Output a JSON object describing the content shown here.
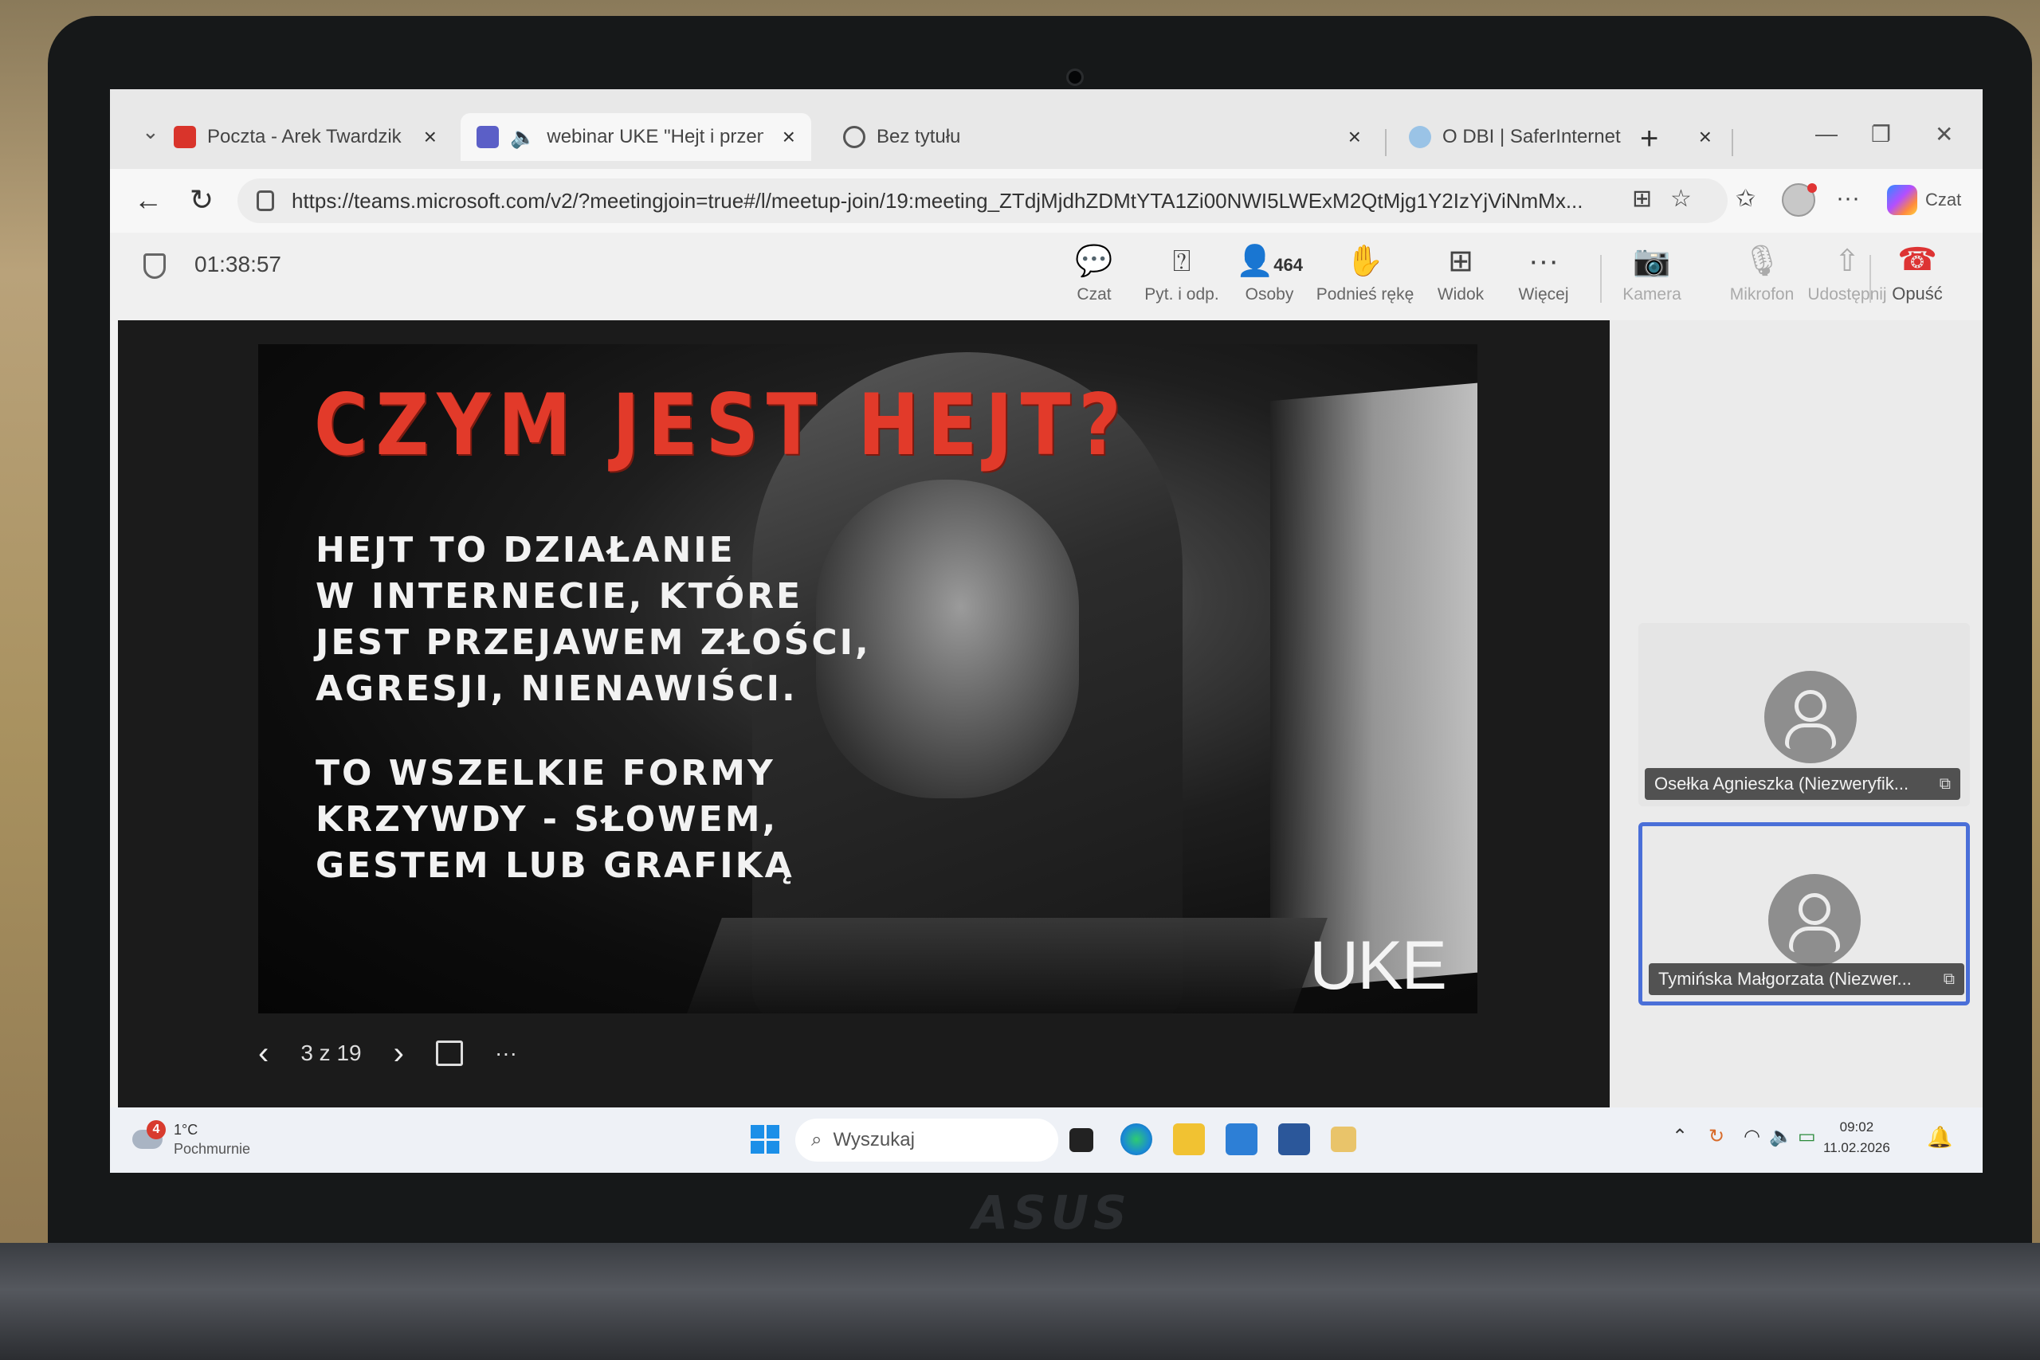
{
  "browser": {
    "tabs": [
      {
        "label": "Poczta - Arek Twardzik - Poczta ho",
        "icon": "mail-icon",
        "color": "#d9342b"
      },
      {
        "label": "webinar UKE \"Hejt i przemoc",
        "icon": "teams-icon",
        "color": "#5b5fc7",
        "active": true
      },
      {
        "label": "Bez tytułu",
        "icon": "globe-icon"
      },
      {
        "label": "O DBI | SaferInternet",
        "icon": "saferinternet-icon"
      }
    ],
    "url": "https://teams.microsoft.com/v2/?meetingjoin=true#/l/meetup-join/19:meeting_ZTdjMjdhZDMtYTA1Zi00NWI5LWExM2QtMjg1Y2IzYjViNmMx...",
    "copilot_label": "Czat"
  },
  "teams": {
    "timer": "01:38:57",
    "toolbar": [
      {
        "label": "Czat",
        "icon": "chat-icon"
      },
      {
        "label": "Pyt. i odp.",
        "icon": "qa-icon"
      },
      {
        "label": "Osoby",
        "icon": "people-icon",
        "count": "464"
      },
      {
        "label": "Podnieś rękę",
        "icon": "raise-hand-icon"
      },
      {
        "label": "Widok",
        "icon": "view-grid-icon"
      },
      {
        "label": "Więcej",
        "icon": "more-icon"
      },
      {
        "label": "Kamera",
        "icon": "camera-off-icon",
        "disabled": true
      },
      {
        "label": "Mikrofon",
        "icon": "mic-off-icon",
        "disabled": true
      },
      {
        "label": "Udostępnij",
        "icon": "share-icon",
        "disabled": true
      }
    ],
    "leave_label": "Opuść",
    "slide": {
      "title": "CZYM JEST HEJT?",
      "paragraph1": [
        "HEJT TO DZIAŁANIE",
        "W INTERNECIE, KTÓRE",
        "JEST PRZEJAWEM ZŁOŚCI,",
        "AGRESJI, NIENAWIŚCI."
      ],
      "paragraph2": [
        "TO WSZELKIE FORMY",
        "KRZYWDY - SŁOWEM,",
        "GESTEM LUB GRAFIKĄ"
      ],
      "logo": "UKE"
    },
    "slide_counter": "3 z 19",
    "participants": [
      {
        "name": "Osełka Agnieszka (Niezweryfik..."
      },
      {
        "name": "Tymińska Małgorzata (Niezwer...",
        "active": true
      }
    ]
  },
  "taskbar": {
    "weather_badge": "4",
    "weather_temp": "1°C",
    "weather_desc": "Pochmurnie",
    "search_placeholder": "Wyszukaj",
    "time": "09:02",
    "date": "11.02.2026"
  },
  "device": {
    "brand": "ASUS"
  },
  "colors": {
    "teams_accent": "#4a6fd8",
    "leave_red": "#d33333",
    "slide_title_red": "#e23a2a"
  }
}
